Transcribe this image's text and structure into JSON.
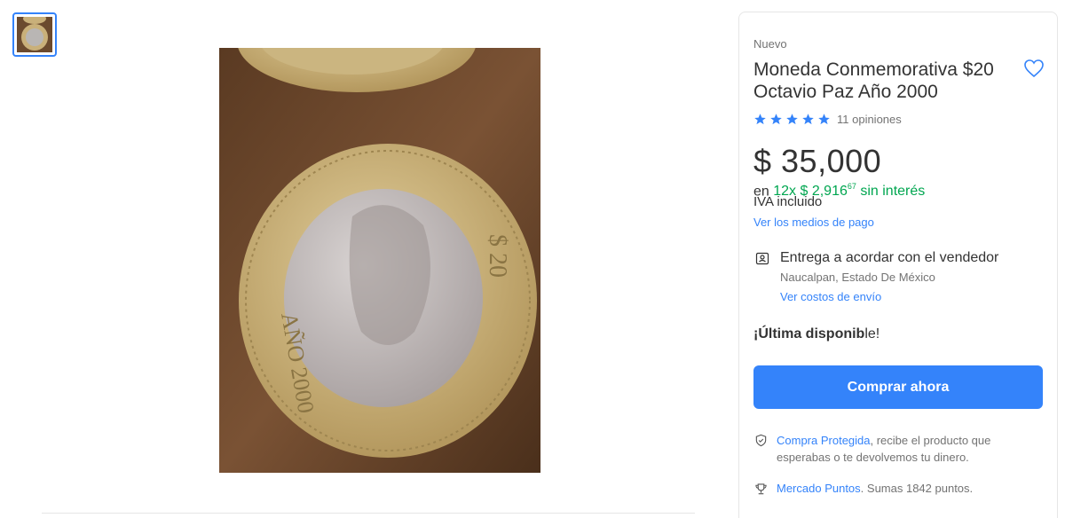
{
  "product": {
    "condition": "Nuevo",
    "title": "Moneda Conmemorativa $20 Octavio Paz Año 2000",
    "rating": {
      "stars": 5,
      "reviews_label": "11 opiniones"
    },
    "price": "$ 35,000",
    "installments": {
      "prefix": "en",
      "amount": "12x $ 2,916",
      "cents": "67",
      "suffix": "sin interés"
    },
    "tax_note": "IVA incluido",
    "payment_link": "Ver los medios de pago"
  },
  "shipping": {
    "title": "Entrega a acordar con el vendedor",
    "location": "Naucalpan, Estado De México",
    "costs_link": "Ver costos de envío"
  },
  "stock": {
    "label": "¡Última disponib",
    "suffix": "le!"
  },
  "buy_button": {
    "label": "Comprar ahora"
  },
  "protection": {
    "link": "Compra Protegida",
    "text": ", recibe el producto que esperabas o te devolvemos tu dinero."
  },
  "points": {
    "link": "Mercado Puntos",
    "text": ". Sumas 1842 puntos."
  },
  "colors": {
    "accent": "#3483fa",
    "green": "#00a650"
  }
}
